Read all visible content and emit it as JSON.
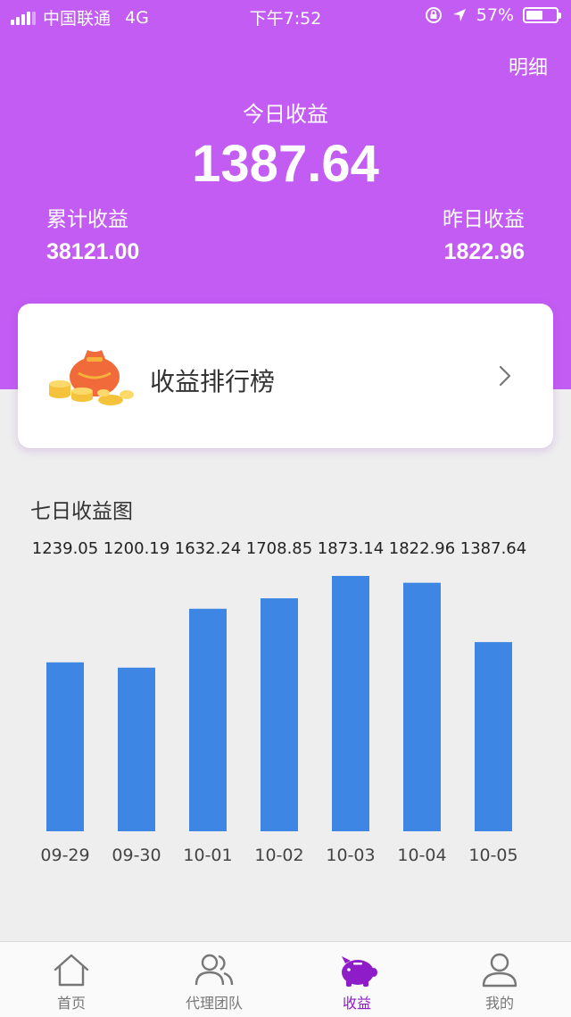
{
  "status_bar": {
    "carrier": "中国联通",
    "network": "4G",
    "time": "下午7:52",
    "battery": "57%",
    "battery_level": 0.57
  },
  "header": {
    "detail_link": "明细",
    "today_label": "今日收益",
    "today_value": "1387.64",
    "total_label": "累计收益",
    "total_value": "38121.00",
    "yesterday_label": "昨日收益",
    "yesterday_value": "1822.96",
    "background_color": "#c25cf2"
  },
  "ranking_card": {
    "title": "收益排行榜",
    "icon": "money-bag-icon",
    "chevron": "chevron-right-icon"
  },
  "chart_section": {
    "title": "七日收益图"
  },
  "chart_data": {
    "type": "bar",
    "categories": [
      "09-29",
      "09-30",
      "10-01",
      "10-02",
      "10-03",
      "10-04",
      "10-05"
    ],
    "values": [
      1239.05,
      1200.19,
      1632.24,
      1708.85,
      1873.14,
      1822.96,
      1387.64
    ],
    "value_labels": [
      "1239.05",
      "1200.19",
      "1632.24",
      "1708.85",
      "1873.14",
      "1822.96",
      "1387.64"
    ],
    "bar_color": "#3d86e3",
    "title": "",
    "xlabel": "",
    "ylabel": ""
  },
  "tab_bar": {
    "items": [
      {
        "label": "首页",
        "icon": "home-icon",
        "active": false
      },
      {
        "label": "代理团队",
        "icon": "team-icon",
        "active": false
      },
      {
        "label": "收益",
        "icon": "piggy-bank-icon",
        "active": true
      },
      {
        "label": "我的",
        "icon": "user-icon",
        "active": false
      }
    ],
    "active_color": "#8f1cc9"
  }
}
